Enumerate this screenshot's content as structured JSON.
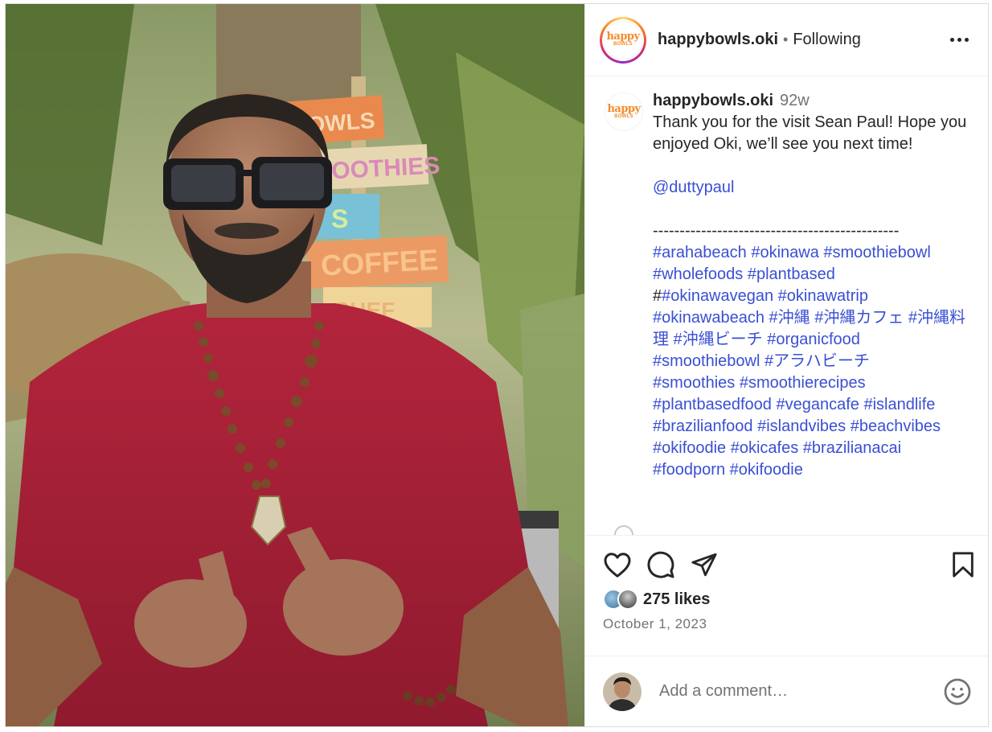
{
  "account": {
    "username": "happybowls.oki",
    "follow_status": "Following",
    "logo_line1": "happy",
    "logo_line2": "BOWLS"
  },
  "photo": {
    "signs": [
      "BOWLS",
      "SMOOTHIES",
      "S",
      "COFFEE",
      "CHEF"
    ]
  },
  "caption": {
    "username": "happybowls.oki",
    "time": "92w",
    "body": "Thank you for the visit Sean Paul! Hope you enjoyed Oki, we’ll see you next time!",
    "mention": "@duttypaul",
    "separator": "----------------------------------------------",
    "hashtag_lines": [
      "#arahabeach #okinawa #smoothiebowl",
      "#wholefoods  #plantbased",
      "##okinawavegan #okinawatrip",
      "#okinawabeach #沖縄 #沖縄カフェ #沖縄料理 #沖縄ビーチ #organicfood",
      "#smoothiebowl #アラハビーチ",
      "#smoothies #smoothierecipes",
      "#plantbasedfood #vegancafe #islandlife",
      "#brazilianfood #islandvibes #beachvibes",
      "#okifoodie #okicafes #brazilianacai",
      "#foodporn #okifoodie"
    ]
  },
  "actions": {
    "like_icon": "heart-icon",
    "comment_icon": "comment-icon",
    "share_icon": "share-icon",
    "save_icon": "bookmark-icon"
  },
  "likes": {
    "label": "275 likes"
  },
  "post_date": "October 1, 2023",
  "comment": {
    "placeholder": "Add a comment…",
    "emoji_icon": "emoji-icon"
  },
  "colors": {
    "link": "#3a4fd3",
    "text": "#262626",
    "muted": "#737373",
    "border": "#dbdbdb"
  }
}
